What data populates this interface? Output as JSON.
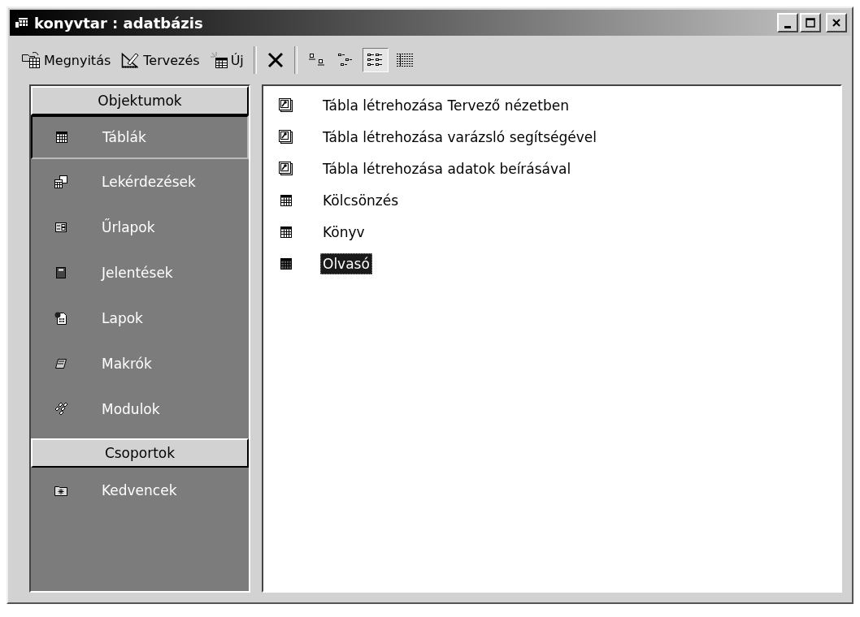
{
  "window": {
    "title": "konyvtar : adatbázis"
  },
  "toolbar": {
    "actions": [
      {
        "label": "Megnyitás"
      },
      {
        "label": "Tervezés"
      },
      {
        "label": "Új"
      }
    ],
    "views": [
      {
        "selected": false
      },
      {
        "selected": false
      },
      {
        "selected": true
      },
      {
        "selected": false
      }
    ]
  },
  "sidebar": {
    "groups": [
      {
        "header": "Objektumok",
        "items": [
          {
            "label": "Táblák",
            "selected": true
          },
          {
            "label": "Lekérdezések",
            "selected": false
          },
          {
            "label": "Űrlapok",
            "selected": false
          },
          {
            "label": "Jelentések",
            "selected": false
          },
          {
            "label": "Lapok",
            "selected": false
          },
          {
            "label": "Makrók",
            "selected": false
          },
          {
            "label": "Modulok",
            "selected": false
          }
        ]
      },
      {
        "header": "Csoportok",
        "items": [
          {
            "label": "Kedvencek",
            "selected": false
          }
        ]
      }
    ]
  },
  "objects": [
    {
      "label": "Tábla létrehozása Tervező nézetben",
      "kind": "shortcut",
      "selected": false
    },
    {
      "label": "Tábla létrehozása varázsló segítségével",
      "kind": "shortcut",
      "selected": false
    },
    {
      "label": "Tábla létrehozása adatok beírásával",
      "kind": "shortcut",
      "selected": false
    },
    {
      "label": "Kölcsönzés",
      "kind": "table",
      "selected": false
    },
    {
      "label": "Könyv",
      "kind": "table",
      "selected": false
    },
    {
      "label": "Olvasó",
      "kind": "table",
      "selected": true
    }
  ]
}
